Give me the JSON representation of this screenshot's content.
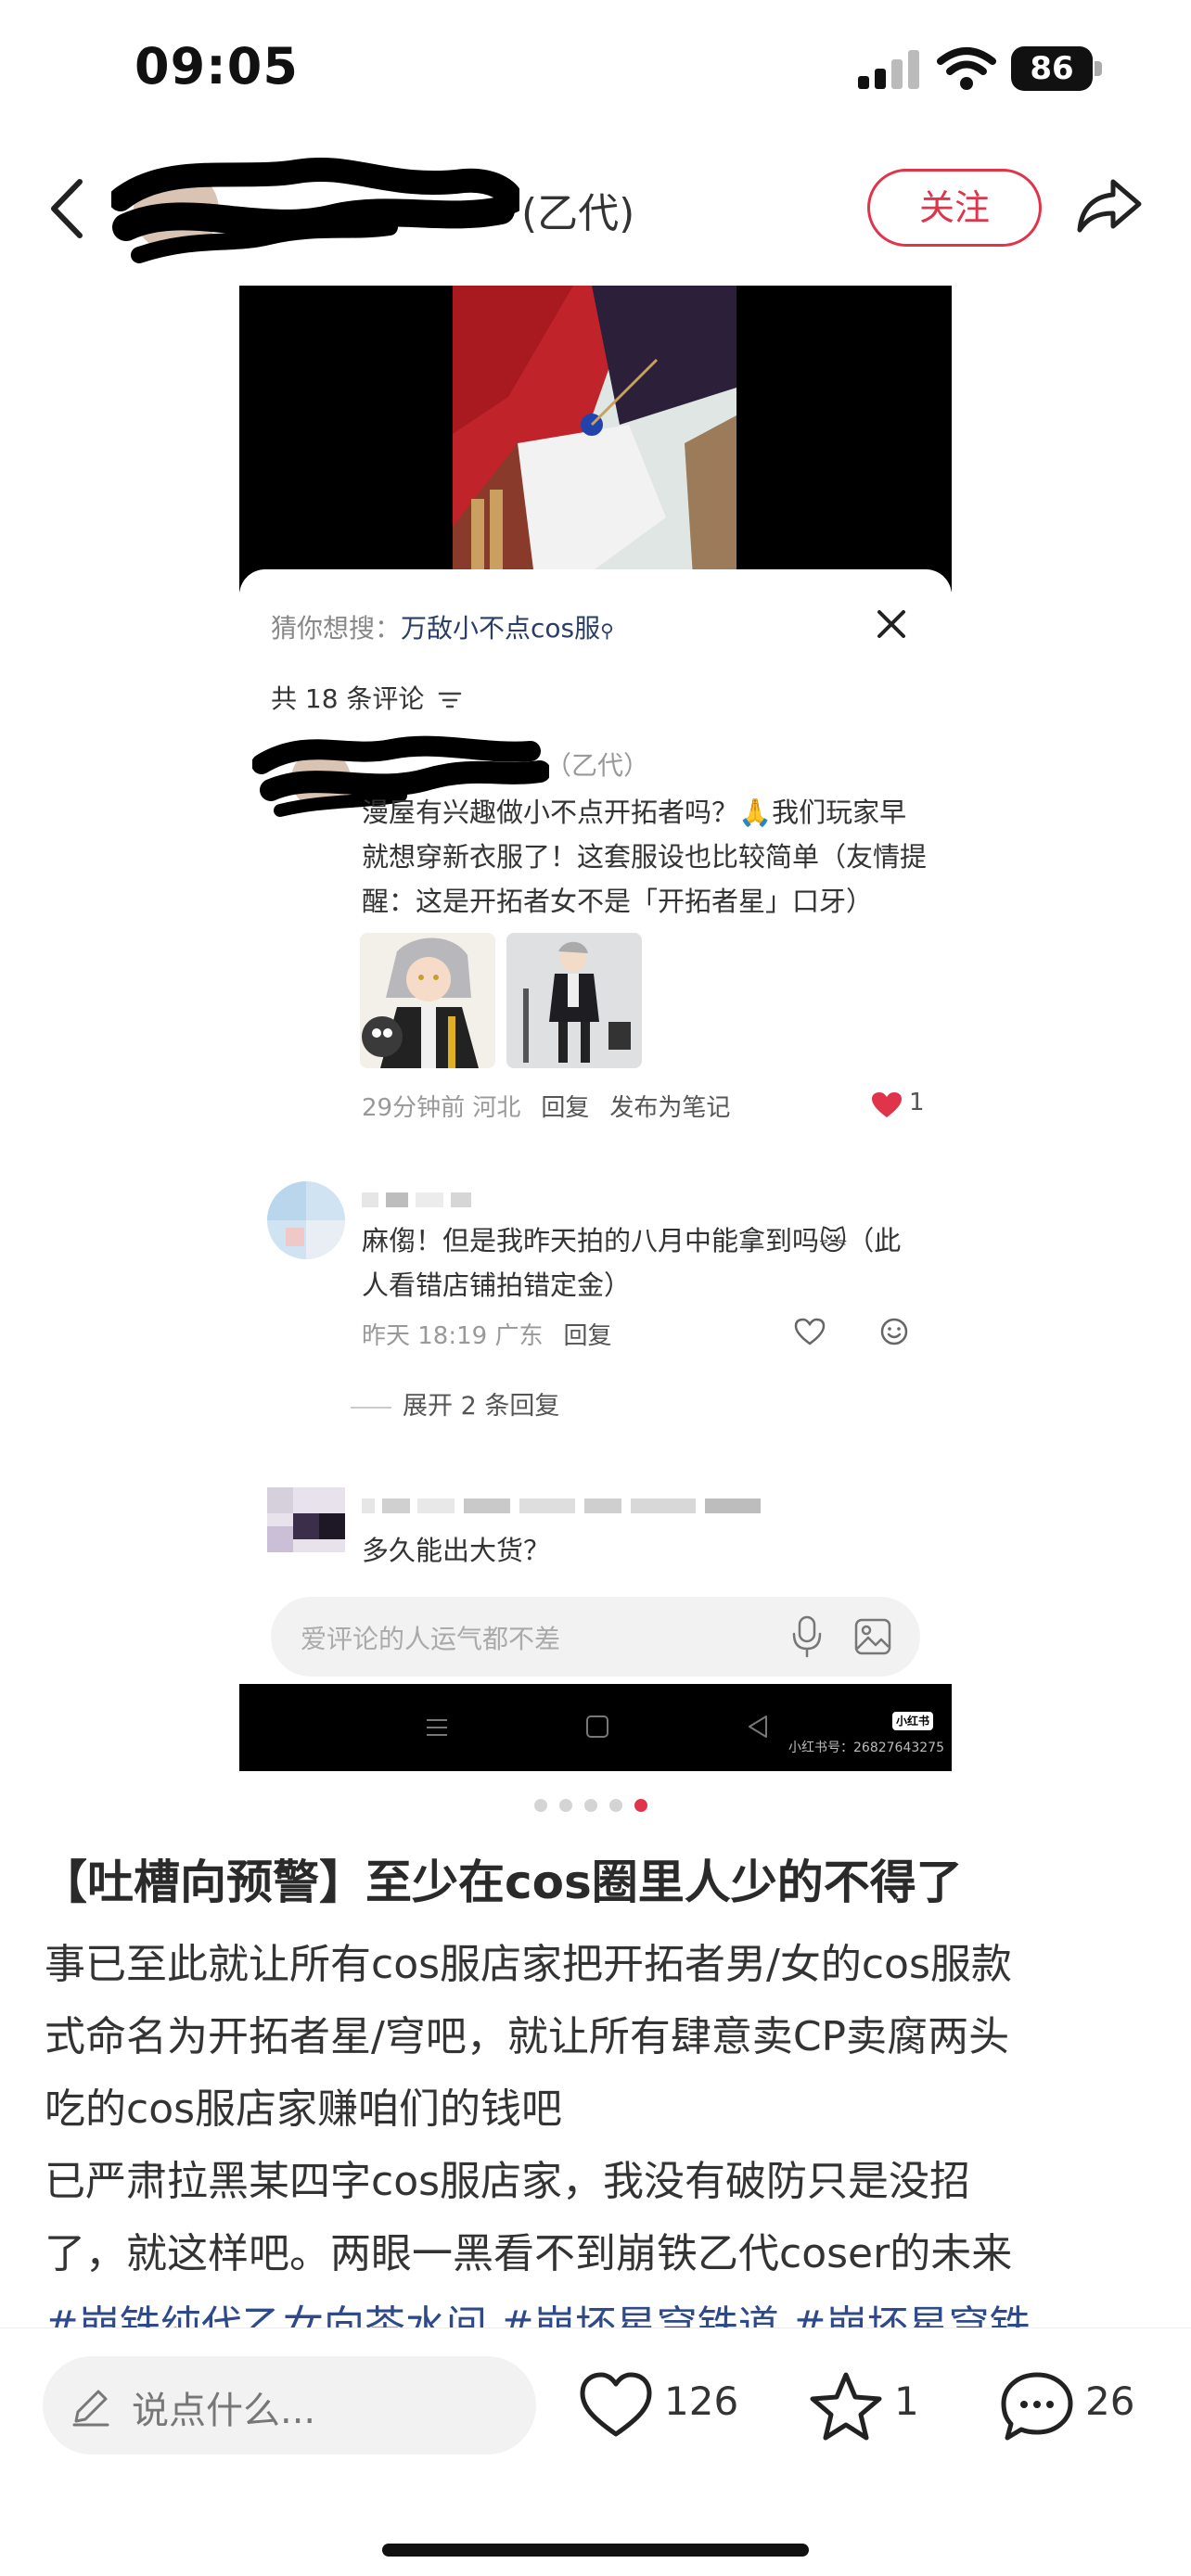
{
  "status_bar": {
    "time": "09:05",
    "battery": "86"
  },
  "header": {
    "author_suffix": "(乙代)",
    "follow_label": "关注",
    "icons": [
      "back-icon",
      "share-icon"
    ]
  },
  "screenshot": {
    "guess_label": "猜你想搜：",
    "guess_keyword": "万敌小不点cos服",
    "comment_count": "共 18 条评论",
    "comments": [
      {
        "name_suffix": "（乙代）",
        "text": "漫屋有兴趣做小不点开拓者吗？🙏我们玩家早就想穿新衣服了！这套服设也比较简单（友情提醒：这是开拓者女不是「开拓者星」口牙）",
        "time_location": "29分钟前 河北",
        "reply": "回复",
        "publish_note": "发布为笔记",
        "likes": "1"
      },
      {
        "text": "麻㑳！但是我昨天拍的八月中能拿到吗😿（此人看错店铺拍错定金）",
        "time_location": "昨天 18:19 广东",
        "reply": "回复",
        "expand": "展开 2 条回复"
      },
      {
        "text": "多久能出大货？"
      }
    ],
    "input_placeholder": "爱评论的人运气都不差",
    "watermark_badge": "小红书",
    "watermark_id": "小红书号：26827643275"
  },
  "pagination": {
    "total": 5,
    "active": 5
  },
  "post": {
    "title": "【吐槽向预警】至少在cos圈里人少的不得了",
    "body_lines": [
      "事已至此就让所有cos服店家把开拓者男/女的cos服款",
      "式命名为开拓者星/穹吧，就让所有肆意卖CP卖腐两头",
      "吃的cos服店家赚咱们的钱吧",
      "已严肃拉黑某四字cos服店家，我没有破防只是没招",
      "了，就这样吧。两眼一黑看不到崩铁乙代coser的未来"
    ],
    "tags": "#崩铁纯代乙女向茶水间 #崩坏星穹铁道 #崩坏星穹铁"
  },
  "bottom_bar": {
    "comment_placeholder": "说点什么...",
    "likes": "126",
    "stars": "1",
    "comments": "26"
  },
  "colors": {
    "accent": "#e0344a",
    "tag_blue": "#2f4a8a"
  }
}
